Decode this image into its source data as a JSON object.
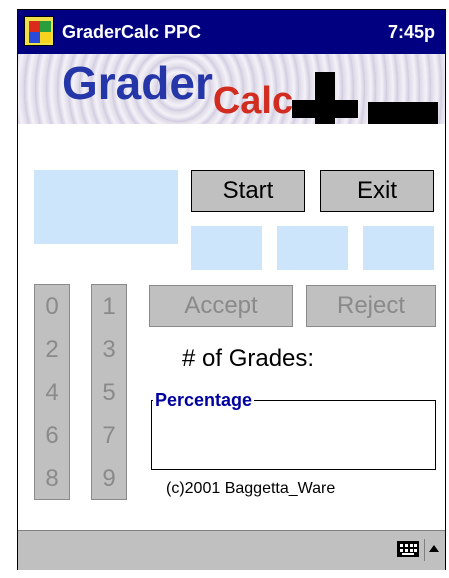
{
  "titlebar": {
    "app_title": "GraderCalc PPC",
    "clock": "7:45p"
  },
  "banner": {
    "logo_grader": "Grader",
    "logo_calc": "Calc"
  },
  "buttons": {
    "start": "Start",
    "exit": "Exit",
    "accept": "Accept",
    "reject": "Reject"
  },
  "keypad": {
    "left": [
      "0",
      "2",
      "4",
      "6",
      "8"
    ],
    "right": [
      "1",
      "3",
      "5",
      "7",
      "9"
    ]
  },
  "labels": {
    "num_grades": "# of Grades:",
    "percentage": "Percentage",
    "copyright": "(c)2001 Baggetta_Ware"
  },
  "taskbar": {
    "keyboard_icon": "keyboard-icon",
    "arrow_icon": "up-arrow-icon"
  },
  "colors": {
    "titlebar": "#000080",
    "display": "#cde5fb",
    "button": "#c0c0c0",
    "disabled_text": "#8a8a8a",
    "percentage_label": "#0000a0"
  }
}
